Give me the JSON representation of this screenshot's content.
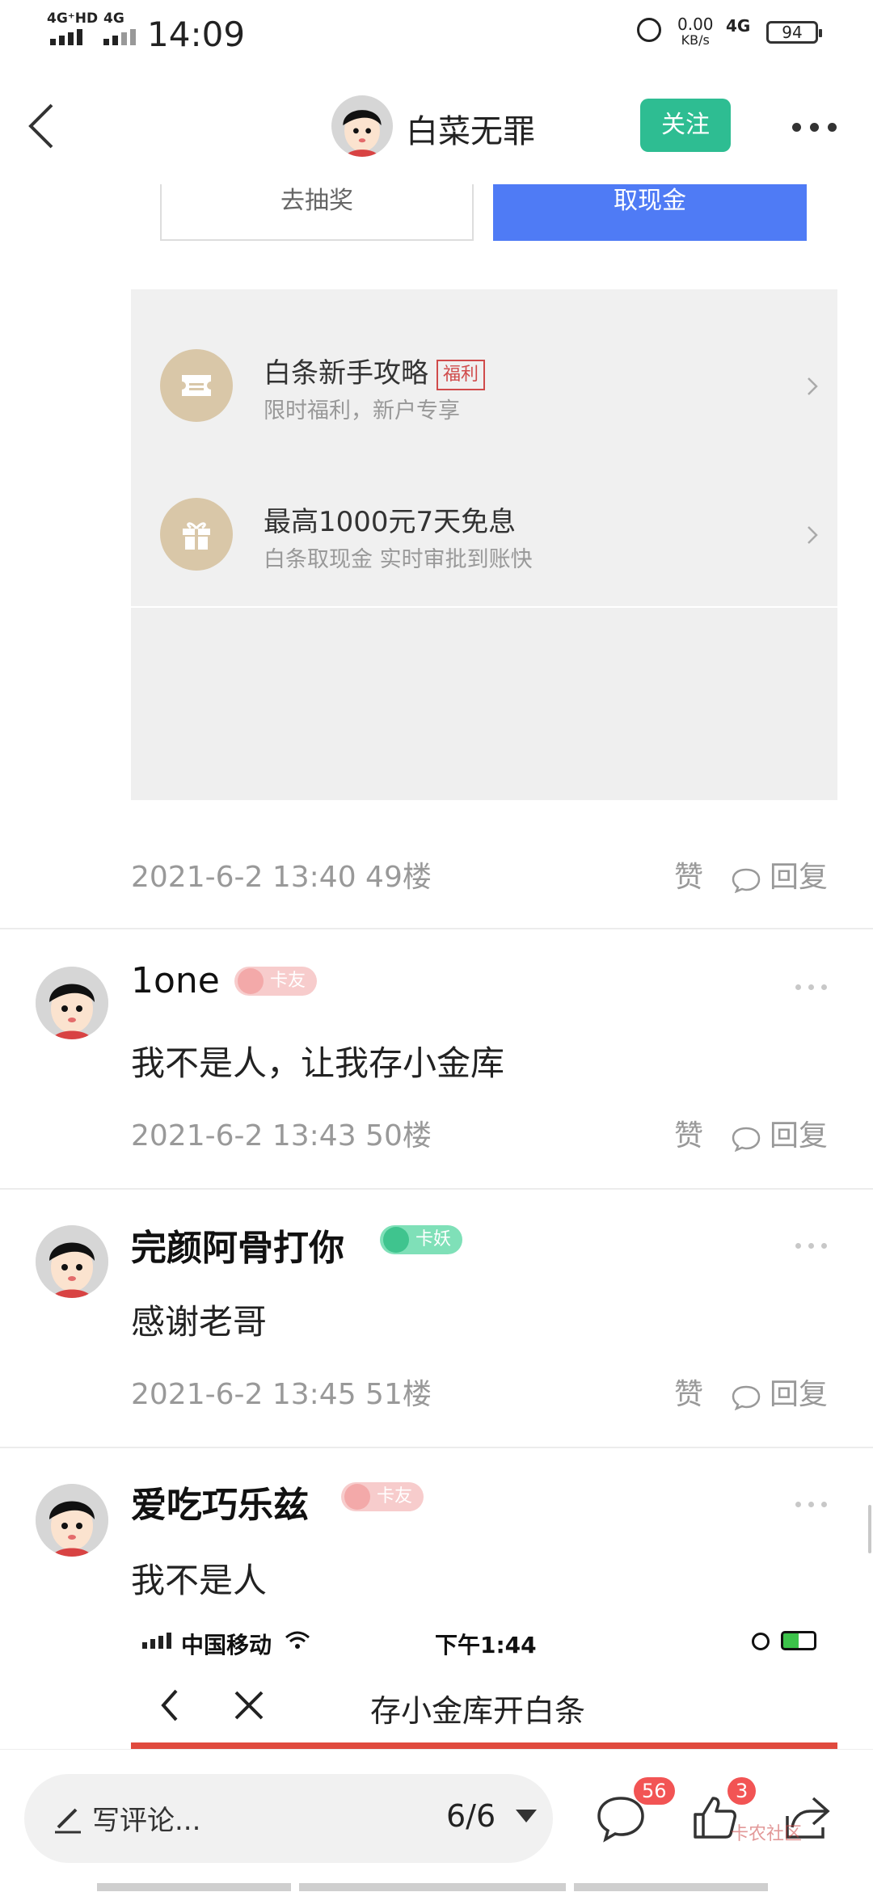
{
  "status_bar": {
    "network_left": "4G⁺HD",
    "network_right": "4G",
    "time": "14:09",
    "speed_value": "0.00",
    "speed_unit": "KB/s",
    "data_type": "4G",
    "battery": "94"
  },
  "header": {
    "title": "白菜无罪",
    "follow_label": "关注"
  },
  "post_image": {
    "button_lottery": "去抽奖",
    "button_cash": "取现金",
    "promo_items": [
      {
        "title": "白条新手攻略",
        "tag": "福利",
        "subtitle": "限时福利，新户专享"
      },
      {
        "title": "最高1000元7天免息",
        "tag": "",
        "subtitle": "白条取现金 实时审批到账快"
      }
    ]
  },
  "floor_49": {
    "meta": "2021-6-2 13:40  49楼",
    "like": "赞",
    "reply": "回复"
  },
  "comments": [
    {
      "name": "1one",
      "badge": "卡友",
      "badge_color": "#f2b1b1",
      "text": "我不是人，让我存小金库",
      "meta": "2021-6-2 13:43  50楼",
      "like": "赞",
      "reply": "回复"
    },
    {
      "name": "完颜阿骨打你",
      "badge": "卡妖",
      "badge_color": "#5fd6a6",
      "text": "感谢老哥",
      "meta": "2021-6-2 13:45  51楼",
      "like": "赞",
      "reply": "回复"
    },
    {
      "name": "爱吃巧乐兹",
      "badge": "卡友",
      "badge_color": "#f2b1b1",
      "text": "我不是人"
    }
  ],
  "embedded_screenshot": {
    "carrier": "中国移动",
    "time": "下午1:44",
    "title": "存小金库开白条"
  },
  "bottom_bar": {
    "comment_placeholder": "写评论...",
    "page": "6/6",
    "comment_count": "56",
    "like_count": "3"
  },
  "watermark": "卡农社区"
}
